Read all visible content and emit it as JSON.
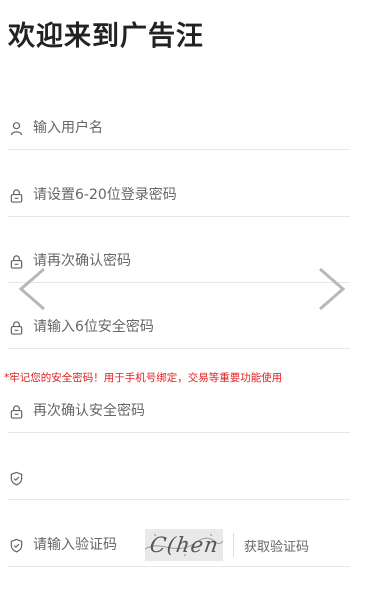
{
  "page": {
    "title": "欢迎来到广告汪"
  },
  "form": {
    "username_placeholder": "输入用户名",
    "password_placeholder": "请设置6-20位登录密码",
    "confirm_password_placeholder": "请再次确认密码",
    "safe_password_placeholder": "请输入6位安全密码",
    "confirm_safe_password_placeholder": "再次确认安全密码",
    "sms_code_value": "",
    "captcha_placeholder": "请输入验证码",
    "captcha_image_text": "C(hen",
    "get_code_label": "获取验证码"
  },
  "notice": {
    "warning_text": "*牢记您的安全密码！用于手机号绑定，交易等重要功能使用"
  },
  "icons": {
    "user": "user-icon",
    "lock": "lock-icon",
    "shield": "shield-check-icon",
    "prev": "chevron-left-icon",
    "next": "chevron-right-icon"
  },
  "colors": {
    "warning": "#e02020",
    "text": "#333333",
    "border": "#e6e6e6"
  }
}
